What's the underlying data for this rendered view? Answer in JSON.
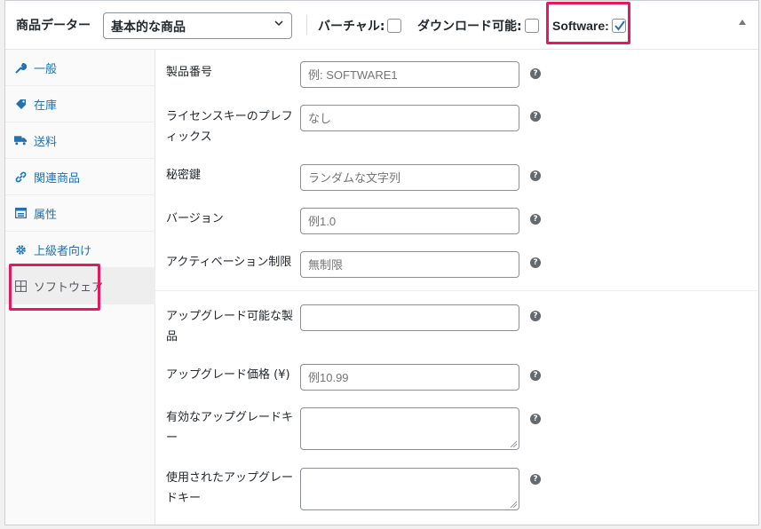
{
  "header": {
    "title": "商品データー",
    "product_type": "基本的な商品",
    "virtual_label": "バーチャル:",
    "virtual_checked": false,
    "downloadable_label": "ダウンロード可能:",
    "downloadable_checked": false,
    "software_label": "Software:",
    "software_checked": true
  },
  "tabs": [
    {
      "label": "一般",
      "icon": "wrench-icon"
    },
    {
      "label": "在庫",
      "icon": "tag-icon"
    },
    {
      "label": "送料",
      "icon": "truck-icon"
    },
    {
      "label": "関連商品",
      "icon": "link-icon"
    },
    {
      "label": "属性",
      "icon": "list-icon"
    },
    {
      "label": "上級者向け",
      "icon": "gear-icon"
    },
    {
      "label": "ソフトウェア",
      "icon": "grid-icon",
      "active": true
    }
  ],
  "fields": {
    "product_id": {
      "label": "製品番号",
      "placeholder": "例: SOFTWARE1"
    },
    "license_prefix": {
      "label": "ライセンスキーのプレフィックス",
      "placeholder": "なし"
    },
    "secret_key": {
      "label": "秘密鍵",
      "placeholder": "ランダムな文字列"
    },
    "version": {
      "label": "バージョン",
      "placeholder": "例1.0"
    },
    "activation_limit": {
      "label": "アクティベーション制限",
      "placeholder": "無制限"
    },
    "upgradable_product": {
      "label": "アップグレード可能な製品",
      "value": ""
    },
    "upgrade_price": {
      "label": "アップグレード価格 (¥)",
      "placeholder": "例10.99"
    },
    "valid_upgrade_keys": {
      "label": "有効なアップグレードキー",
      "value": ""
    },
    "used_upgrade_keys": {
      "label": "使用されたアップグレードキー",
      "value": ""
    }
  },
  "colors": {
    "accent": "#2271b1",
    "highlight": "#e5195f"
  }
}
